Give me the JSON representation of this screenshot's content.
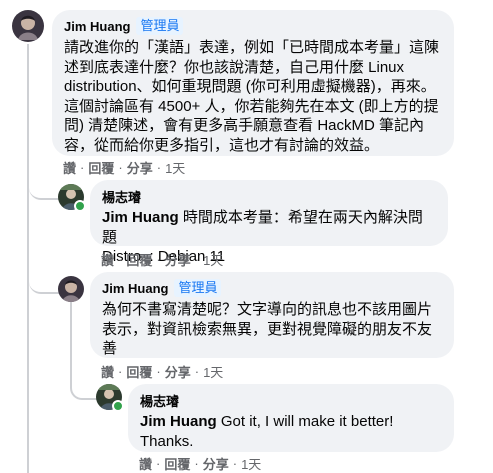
{
  "comments": [
    {
      "author": "Jim Huang",
      "badge": "管理員",
      "lines": [
        "請改進你的「漢語」表達，例如「已時間成本考量」這陳",
        "述到底表達什麼？你也該說清楚，自己用什麼 Linux",
        "distribution、如何重現問題 (你可利用虛擬機器)，再來。",
        "這個討論區有 4500+ 人，你若能夠先在本文 (即上方的提",
        "問) 清楚陳述，會有更多高手願意查看 HackMD 筆記內",
        "容，從而給你更多指引，這也才有討論的效益。"
      ],
      "actions": {
        "read": "讚",
        "reply": "回覆",
        "share": "分享",
        "time": "1天"
      }
    },
    {
      "author": "楊志璿",
      "mention": "Jim Huang",
      "lines_after_mention": " 時間成本考量：希望在兩天內解決問題",
      "line2": "Distro. : Debian 11",
      "actions": {
        "read": "讚",
        "reply": "回覆",
        "share": "分享",
        "time": "1天"
      }
    },
    {
      "author": "Jim Huang",
      "badge": "管理員",
      "lines": [
        "為何不書寫清楚呢？文字導向的訊息也不該用圖片",
        "表示，對資訊檢索無異，更對視覺障礙的朋友不友",
        "善"
      ],
      "actions": {
        "read": "讚",
        "reply": "回覆",
        "share": "分享",
        "time": "1天"
      }
    },
    {
      "author": "楊志璿",
      "mention": "Jim Huang",
      "lines_after_mention": " Got it, I will make it better!",
      "line2": "Thanks.",
      "actions": {
        "read": "讚",
        "reply": "回覆",
        "share": "分享",
        "time": "1天"
      }
    }
  ]
}
